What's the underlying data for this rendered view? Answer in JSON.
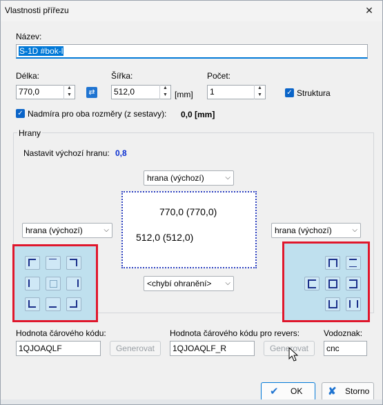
{
  "window": {
    "title": "Vlastnosti přířezu",
    "close_glyph": "✕"
  },
  "name": {
    "label": "Název:",
    "value": "S-1D #bok-l"
  },
  "length": {
    "label": "Délka:",
    "value": "770,0"
  },
  "width": {
    "label": "Šířka:",
    "value": "512,0",
    "unit": "[mm]"
  },
  "count": {
    "label": "Počet:",
    "value": "1"
  },
  "structure": {
    "label": "Struktura",
    "checked": true
  },
  "oversize": {
    "label": "Nadmíra pro oba rozměry (z sestavy):",
    "value": "0,0 [mm]",
    "checked": true
  },
  "edges": {
    "group_label": "Hrany",
    "default_edge_label": "Nastavit výchozí hranu:",
    "default_edge_value": "0,8",
    "top": "hrana (výchozí)",
    "left": "hrana (výchozí)",
    "right": "hrana (výchozí)",
    "bottom": "<chybí ohranění>",
    "preview_length": "770,0 (770,0)",
    "preview_width": "512,0 (512,0)"
  },
  "barcode": {
    "label": "Hodnota čárového kódu:",
    "value": "1QJOAQLF",
    "generate": "Generovat"
  },
  "barcode_reverse": {
    "label": "Hodnota čárového kódu pro revers:",
    "value": "1QJOAQLF_R",
    "generate": "Generovat"
  },
  "watermark": {
    "label": "Vodoznak:",
    "value": "cnc"
  },
  "buttons": {
    "ok": "OK",
    "cancel": "Storno"
  },
  "colors": {
    "accent": "#0078d7",
    "highlight": "#e0162b",
    "panel": "#bfe0ee"
  }
}
